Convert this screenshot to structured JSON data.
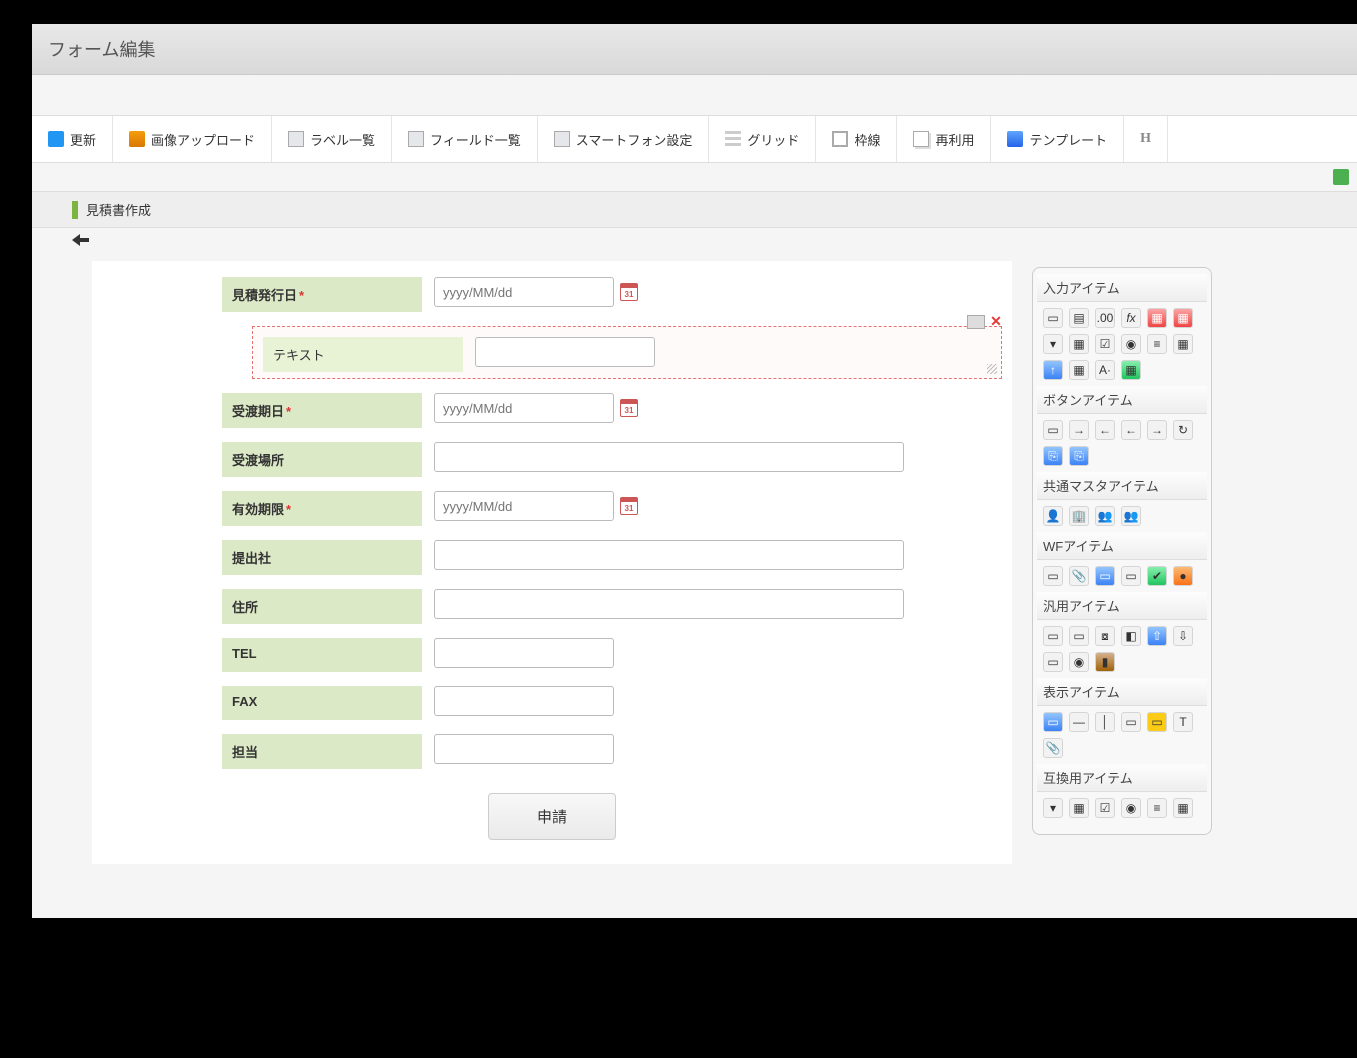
{
  "page_title": "フォーム編集",
  "toolbar": {
    "update": "更新",
    "image_upload": "画像アップロード",
    "label_list": "ラベル一覧",
    "field_list": "フィールド一覧",
    "smartphone": "スマートフォン設定",
    "grid": "グリッド",
    "border": "枠線",
    "reuse": "再利用",
    "template": "テンプレート",
    "h": "H"
  },
  "breadcrumb": {
    "title": "見積書作成"
  },
  "form": {
    "issue_date": {
      "label": "見積発行日",
      "required": true,
      "placeholder": "yyyy/MM/dd"
    },
    "selected_text": {
      "label": "テキスト",
      "value": ""
    },
    "due_date": {
      "label": "受渡期日",
      "required": true,
      "placeholder": "yyyy/MM/dd"
    },
    "delivery_place": {
      "label": "受渡場所",
      "value": ""
    },
    "expiry": {
      "label": "有効期限",
      "required": true,
      "placeholder": "yyyy/MM/dd"
    },
    "submitter": {
      "label": "提出社",
      "value": ""
    },
    "address": {
      "label": "住所",
      "value": ""
    },
    "tel": {
      "label": "TEL",
      "value": ""
    },
    "fax": {
      "label": "FAX",
      "value": ""
    },
    "person": {
      "label": "担当",
      "value": ""
    },
    "submit": "申請"
  },
  "palette": {
    "sections": {
      "input": "入力アイテム",
      "button": "ボタンアイテム",
      "master": "共通マスタアイテム",
      "wf": "WFアイテム",
      "generic": "汎用アイテム",
      "display": "表示アイテム",
      "compat": "互換用アイテム"
    }
  }
}
